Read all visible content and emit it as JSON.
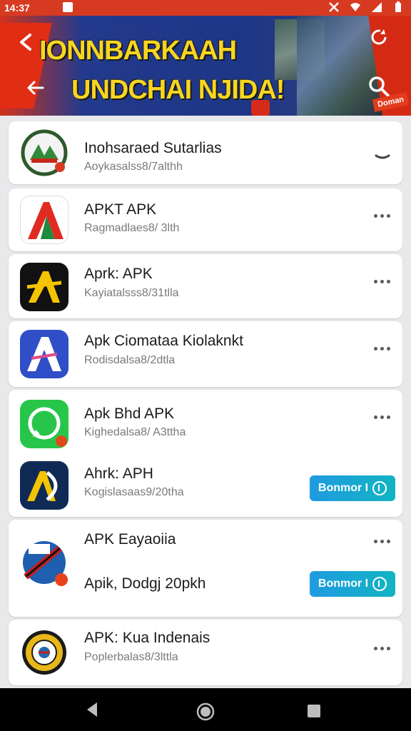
{
  "status_bar": {
    "time": "14:37"
  },
  "banner": {
    "line1": "IONNBARKAAH",
    "line2": "UNDCHAI NJIDA!",
    "stamp": "Doman"
  },
  "apps": [
    {
      "name": "Inohsaraed Sutarlias",
      "sub": "Aoykasalss8/7althh",
      "action": "dash"
    },
    {
      "name": "APKT APK",
      "sub": "Ragmadlaes8/ 3lth",
      "action": "more"
    },
    {
      "name": "Aprk: APK",
      "sub": "Kayiatalsss8/31tlla",
      "action": "more"
    },
    {
      "name": "Apk Ciomataa Kiolaknkt",
      "sub": "Rodisdalsa8/2dtla",
      "action": "more"
    },
    {
      "name": "Apk Bhd APK",
      "sub": "Kighedalsa8/ A3ttha",
      "action": "more"
    },
    {
      "name": "Ahrk: APH",
      "sub": "Kogislasaas9/20tha",
      "action": "install"
    },
    {
      "name": "APK Eayaoiia",
      "sub": "",
      "action": "more"
    },
    {
      "name": "Apik, Dodgj 20pkh",
      "sub": "",
      "action": "install"
    },
    {
      "name": "APK: Kua Indenais",
      "sub": "Poplerbalas8/3lttla",
      "action": "more"
    }
  ],
  "install_label": "Bonmor I",
  "colors": {
    "accent": "#1f9be0",
    "banner_red": "#d63b22",
    "banner_blue": "#1e3686",
    "title_yellow": "#f7d622"
  }
}
